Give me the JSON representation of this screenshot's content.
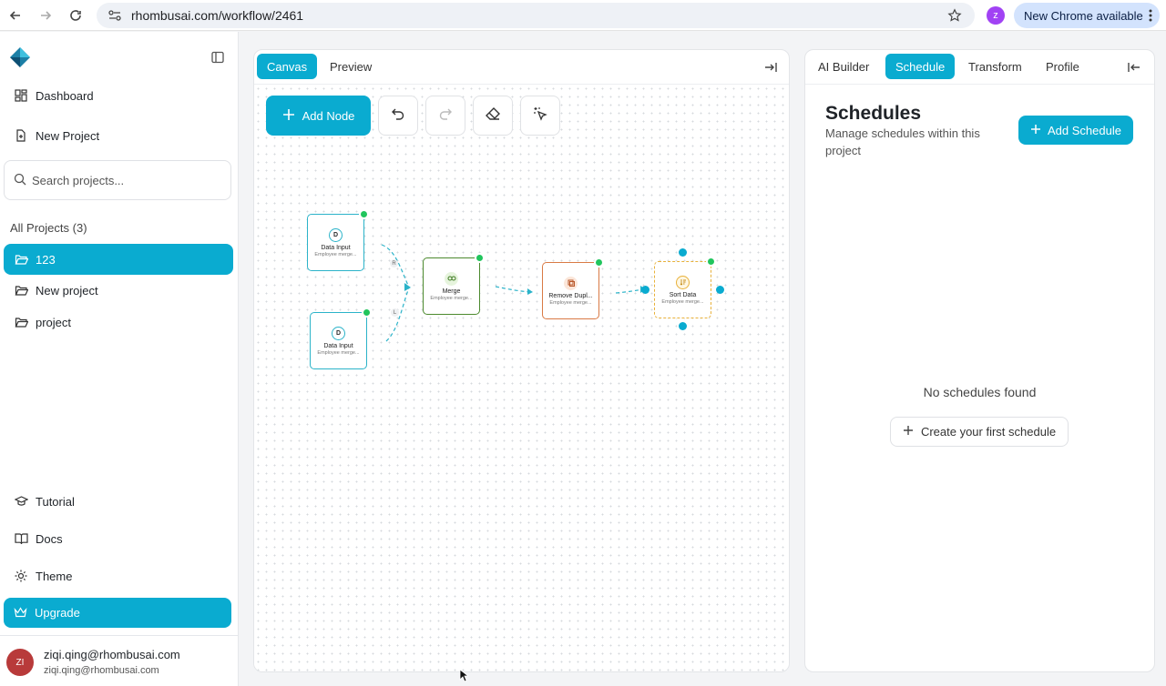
{
  "browser": {
    "url": "rhombusai.com/workflow/2461",
    "profile_initial": "z",
    "update_label": "New Chrome available"
  },
  "sidebar": {
    "dashboard": "Dashboard",
    "new_project": "New Project",
    "search_placeholder": "Search projects...",
    "all_projects_label": "All Projects (3)",
    "projects": [
      {
        "label": "123",
        "active": true
      },
      {
        "label": "New project",
        "active": false
      },
      {
        "label": "project",
        "active": false
      }
    ],
    "tutorial": "Tutorial",
    "docs": "Docs",
    "theme": "Theme",
    "upgrade": "Upgrade",
    "user": {
      "initials": "ZI",
      "name": "ziqi.qing@rhombusai.com",
      "email": "ziqi.qing@rhombusai.com"
    }
  },
  "canvas_panel": {
    "tabs": [
      {
        "label": "Canvas",
        "active": true
      },
      {
        "label": "Preview",
        "active": false
      }
    ],
    "toolbar": {
      "add_node": "Add Node"
    },
    "nodes": [
      {
        "title": "Data Input",
        "subtitle": "Employee merge...",
        "icon_letter": "D",
        "color": "#2bb3c9"
      },
      {
        "title": "Data Input",
        "subtitle": "Employee merge...",
        "icon_letter": "D",
        "color": "#2bb3c9"
      },
      {
        "title": "Merge",
        "subtitle": "Employee merge...",
        "icon_letter": "",
        "color": "#4c8a2e"
      },
      {
        "title": "Remove Dupl...",
        "subtitle": "Employee merge...",
        "icon_letter": "",
        "color": "#d97a45"
      },
      {
        "title": "Sort Data",
        "subtitle": "Employee merge...",
        "icon_letter": "",
        "color": "#e8b13a"
      }
    ],
    "edge_labels": [
      "R",
      "L"
    ]
  },
  "right_panel": {
    "tabs": [
      {
        "label": "AI Builder",
        "active": false
      },
      {
        "label": "Schedule",
        "active": true
      },
      {
        "label": "Transform",
        "active": false
      },
      {
        "label": "Profile",
        "active": false
      }
    ],
    "title": "Schedules",
    "subtitle": "Manage schedules within this project",
    "add_button": "Add Schedule",
    "empty_text": "No schedules found",
    "create_first": "Create your first schedule"
  },
  "colors": {
    "accent": "#0aabd0",
    "success": "#21c55d"
  }
}
